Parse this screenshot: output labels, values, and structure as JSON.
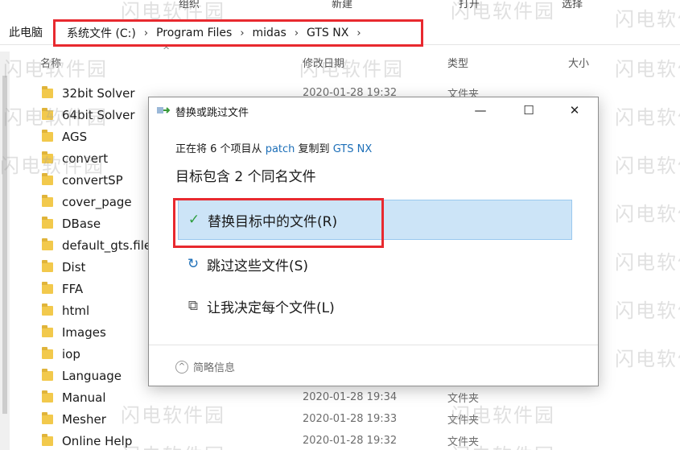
{
  "ribbon": {
    "groups": [
      "组织",
      "新建",
      "打开",
      "选择"
    ]
  },
  "address_bar": {
    "this_pc": "此电脑",
    "breadcrumbs": [
      "系统文件 (C:)",
      "Program Files",
      "midas",
      "GTS NX"
    ]
  },
  "columns": {
    "name": "名称",
    "modified": "修改日期",
    "type": "类型",
    "size": "大小"
  },
  "files": [
    {
      "name": "32bit Solver",
      "date": "2020-01-28 19:32",
      "type": "文件夹"
    },
    {
      "name": "64bit Solver",
      "date": "",
      "type": ""
    },
    {
      "name": "AGS",
      "date": "",
      "type": ""
    },
    {
      "name": "convert",
      "date": "",
      "type": ""
    },
    {
      "name": "convertSP",
      "date": "",
      "type": ""
    },
    {
      "name": "cover_page",
      "date": "",
      "type": ""
    },
    {
      "name": "DBase",
      "date": "",
      "type": ""
    },
    {
      "name": "default_gts.file",
      "date": "",
      "type": ""
    },
    {
      "name": "Dist",
      "date": "",
      "type": ""
    },
    {
      "name": "FFA",
      "date": "",
      "type": ""
    },
    {
      "name": "html",
      "date": "",
      "type": ""
    },
    {
      "name": "Images",
      "date": "",
      "type": ""
    },
    {
      "name": "iop",
      "date": "",
      "type": ""
    },
    {
      "name": "Language",
      "date": "",
      "type": ""
    },
    {
      "name": "Manual",
      "date": "2020-01-28 19:34",
      "type": "文件夹"
    },
    {
      "name": "Mesher",
      "date": "2020-01-28 19:33",
      "type": "文件夹"
    },
    {
      "name": "Online Help",
      "date": "2020-01-28 19:32",
      "type": "文件夹"
    }
  ],
  "dialog": {
    "title": "替换或跳过文件",
    "copy_prefix": "正在将 6 个项目从",
    "source": "patch",
    "copy_middle": "复制到",
    "dest": "GTS NX",
    "heading": "目标包含 2 个同名文件",
    "opt_replace": "替换目标中的文件(R)",
    "opt_skip": "跳过这些文件(S)",
    "opt_decide": "让我决定每个文件(L)",
    "details": "简略信息",
    "icons": {
      "replace": "checkmark-icon",
      "skip": "skip-arrow-icon",
      "decide": "compare-files-icon",
      "details": "chevron-up-icon"
    }
  },
  "watermark": "闪电软件园",
  "colors": {
    "highlight_red": "#e8292f",
    "selected_option": "#cce4f7",
    "link": "#1d6fb8",
    "folder": "#f2c94c"
  }
}
